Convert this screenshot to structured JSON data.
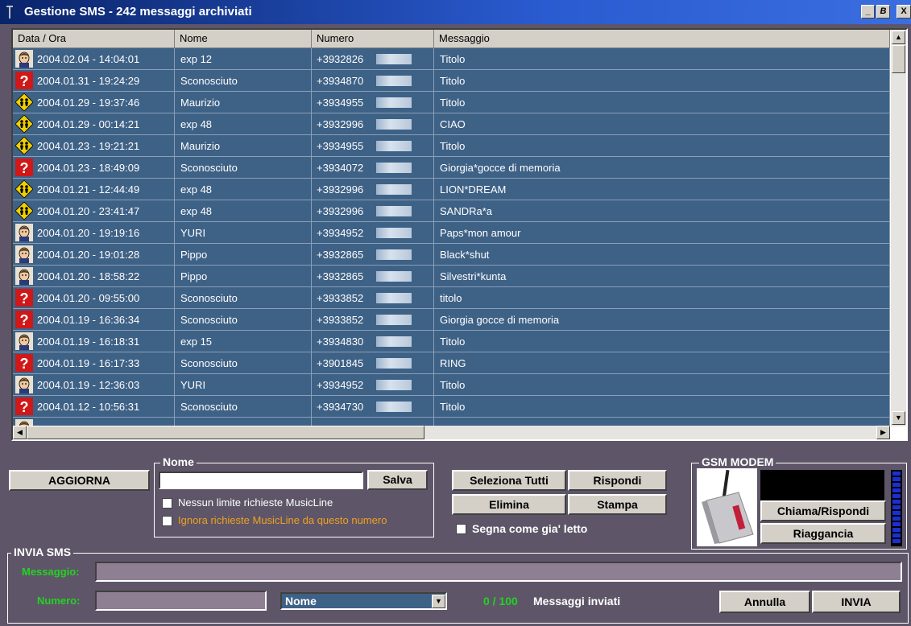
{
  "window": {
    "title": "Gestione SMS -  242 messaggi archiviati",
    "controls": [
      "_",
      "B",
      "X"
    ]
  },
  "table": {
    "columns": [
      "Data / Ora",
      "Nome",
      "Numero",
      "Messaggio"
    ],
    "rows": [
      {
        "icon": "person-icon",
        "date": "2004.02.04 - 14:04:01",
        "name": "exp 12",
        "number": "+3932826",
        "message": "Titolo"
      },
      {
        "icon": "unknown-icon",
        "date": "2004.01.31 - 19:24:29",
        "name": "Sconosciuto",
        "number": "+3934870",
        "message": "Titolo"
      },
      {
        "icon": "group-icon",
        "date": "2004.01.29 - 19:37:46",
        "name": "Maurizio",
        "number": "+3934955",
        "message": "Titolo"
      },
      {
        "icon": "group-icon",
        "date": "2004.01.29 - 00:14:21",
        "name": "exp 48",
        "number": "+3932996",
        "message": "CIAO"
      },
      {
        "icon": "group-icon",
        "date": "2004.01.23 - 19:21:21",
        "name": "Maurizio",
        "number": "+3934955",
        "message": "Titolo"
      },
      {
        "icon": "unknown-icon",
        "date": "2004.01.23 - 18:49:09",
        "name": "Sconosciuto",
        "number": "+3934072",
        "message": "Giorgia*gocce di memoria"
      },
      {
        "icon": "group-icon",
        "date": "2004.01.21 - 12:44:49",
        "name": "exp 48",
        "number": "+3932996",
        "message": "LION*DREAM"
      },
      {
        "icon": "group-icon",
        "date": "2004.01.20 - 23:41:47",
        "name": "exp 48",
        "number": "+3932996",
        "message": "SANDRa*a"
      },
      {
        "icon": "person-icon",
        "date": "2004.01.20 - 19:19:16",
        "name": "YURI",
        "number": "+3934952",
        "message": "Paps*mon amour"
      },
      {
        "icon": "person-icon",
        "date": "2004.01.20 - 19:01:28",
        "name": "Pippo",
        "number": "+3932865",
        "message": "Black*shut"
      },
      {
        "icon": "person-icon",
        "date": "2004.01.20 - 18:58:22",
        "name": "Pippo",
        "number": "+3932865",
        "message": "Silvestri*kunta"
      },
      {
        "icon": "unknown-icon",
        "date": "2004.01.20 - 09:55:00",
        "name": "Sconosciuto",
        "number": "+3933852",
        "message": "titolo"
      },
      {
        "icon": "unknown-icon",
        "date": "2004.01.19 - 16:36:34",
        "name": "Sconosciuto",
        "number": "+3933852",
        "message": "Giorgia gocce di memoria"
      },
      {
        "icon": "person-icon",
        "date": "2004.01.19 - 16:18:31",
        "name": "exp 15",
        "number": "+3934830",
        "message": "Titolo"
      },
      {
        "icon": "unknown-icon",
        "date": "2004.01.19 - 16:17:33",
        "name": "Sconosciuto",
        "number": "+3901845",
        "message": "RING"
      },
      {
        "icon": "person-icon",
        "date": "2004.01.19 - 12:36:03",
        "name": "YURI",
        "number": "+3934952",
        "message": "Titolo"
      },
      {
        "icon": "unknown-icon",
        "date": "2004.01.12 - 10:56:31",
        "name": "Sconosciuto",
        "number": "+3934730",
        "message": "Titolo"
      },
      {
        "icon": "person-icon",
        "date": "",
        "name": "",
        "number": "",
        "message": ""
      }
    ]
  },
  "actions": {
    "refresh": "AGGIORNA",
    "select_all": "Seleziona Tutti",
    "reply": "Rispondi",
    "delete": "Elimina",
    "print": "Stampa",
    "mark_read": "Segna come gia' letto"
  },
  "name_group": {
    "label": "Nome",
    "value": "",
    "save": "Salva",
    "option1": "Nessun limite richieste MusicLine",
    "option2": "Ignora richieste MusicLine da questo numero"
  },
  "gsm": {
    "label": "GSM MODEM",
    "call_answer": "Chiama/Rispondi",
    "hang_up": "Riaggancia",
    "signal_level": 1.0
  },
  "send": {
    "label": "INVIA SMS",
    "message_label": "Messaggio:",
    "message_value": "",
    "number_label": "Numero:",
    "number_value": "",
    "name_select": "Nome",
    "counter": "0 / 100",
    "sent_label": "Messaggi inviati",
    "cancel": "Annulla",
    "send": "INVIA"
  },
  "colors": {
    "background": "#5e5668",
    "row_bg": "#3e6186",
    "accent_green": "#22d322",
    "option_orange": "#f0a020"
  }
}
